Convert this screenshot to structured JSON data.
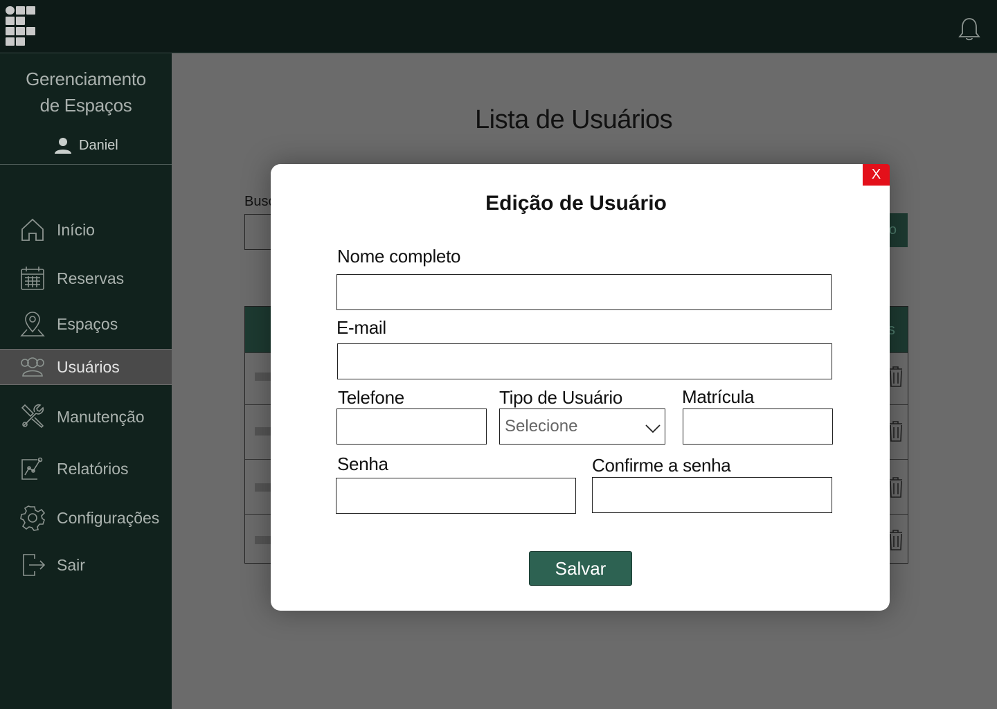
{
  "header": {
    "logo_icon": "grid-logo-icon",
    "notification_icon": "bell-icon"
  },
  "sidebar": {
    "title_line1": "Gerenciamento",
    "title_line2": "de Espaços",
    "user_name": "Daniel",
    "items": [
      {
        "label": "Início",
        "icon": "home-icon"
      },
      {
        "label": "Reservas",
        "icon": "calendar-icon"
      },
      {
        "label": "Espaços",
        "icon": "map-pin-icon"
      },
      {
        "label": "Usuários",
        "icon": "users-icon",
        "active": true
      },
      {
        "label": "Manutenção",
        "icon": "tools-icon"
      },
      {
        "label": "Relatórios",
        "icon": "report-icon"
      },
      {
        "label": "Configurações",
        "icon": "gear-icon"
      },
      {
        "label": "Sair",
        "icon": "logout-icon"
      }
    ]
  },
  "main": {
    "title": "Lista de Usuários",
    "search_label": "Busc",
    "new_button_fragment": "o",
    "table_header_fragment": "s"
  },
  "modal": {
    "title": "Edição de Usuário",
    "close_label": "X",
    "fields": {
      "name_label": "Nome completo",
      "email_label": "E-mail",
      "phone_label": "Telefone",
      "type_label": "Tipo de Usuário",
      "type_placeholder": "Selecione",
      "registration_label": "Matrícula",
      "password_label": "Senha",
      "confirm_label": "Confirme a senha"
    },
    "save_label": "Salvar"
  },
  "colors": {
    "topbar": "#0d1a17",
    "sidebar": "#11221d",
    "accent_green": "#2d6252",
    "close_red": "#e3101a"
  }
}
